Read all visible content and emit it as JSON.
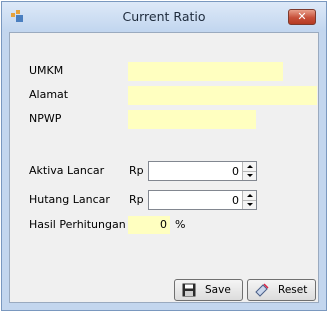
{
  "window": {
    "title": "Current Ratio",
    "close_label": "✕"
  },
  "form": {
    "umkm_label": "UMKM",
    "alamat_label": "Alamat",
    "npwp_label": "NPWP",
    "umkm_value": "",
    "alamat_value": "",
    "npwp_value": "",
    "aktiva_label": "Aktiva Lancar",
    "hutang_label": "Hutang Lancar",
    "currency": "Rp",
    "aktiva_value": "0",
    "hutang_value": "0",
    "hasil_label": "Hasil Perhitungan",
    "hasil_value": "0",
    "percent": "%"
  },
  "buttons": {
    "save_label": "Save",
    "reset_label": "Reset"
  },
  "colors": {
    "readonly_field": "#ffffc0",
    "client_bg": "#f0f0f0",
    "close_button": "#c7503a"
  },
  "icons": {
    "app": "form-icon",
    "save": "floppy-disk-icon",
    "reset": "reset-icon"
  }
}
